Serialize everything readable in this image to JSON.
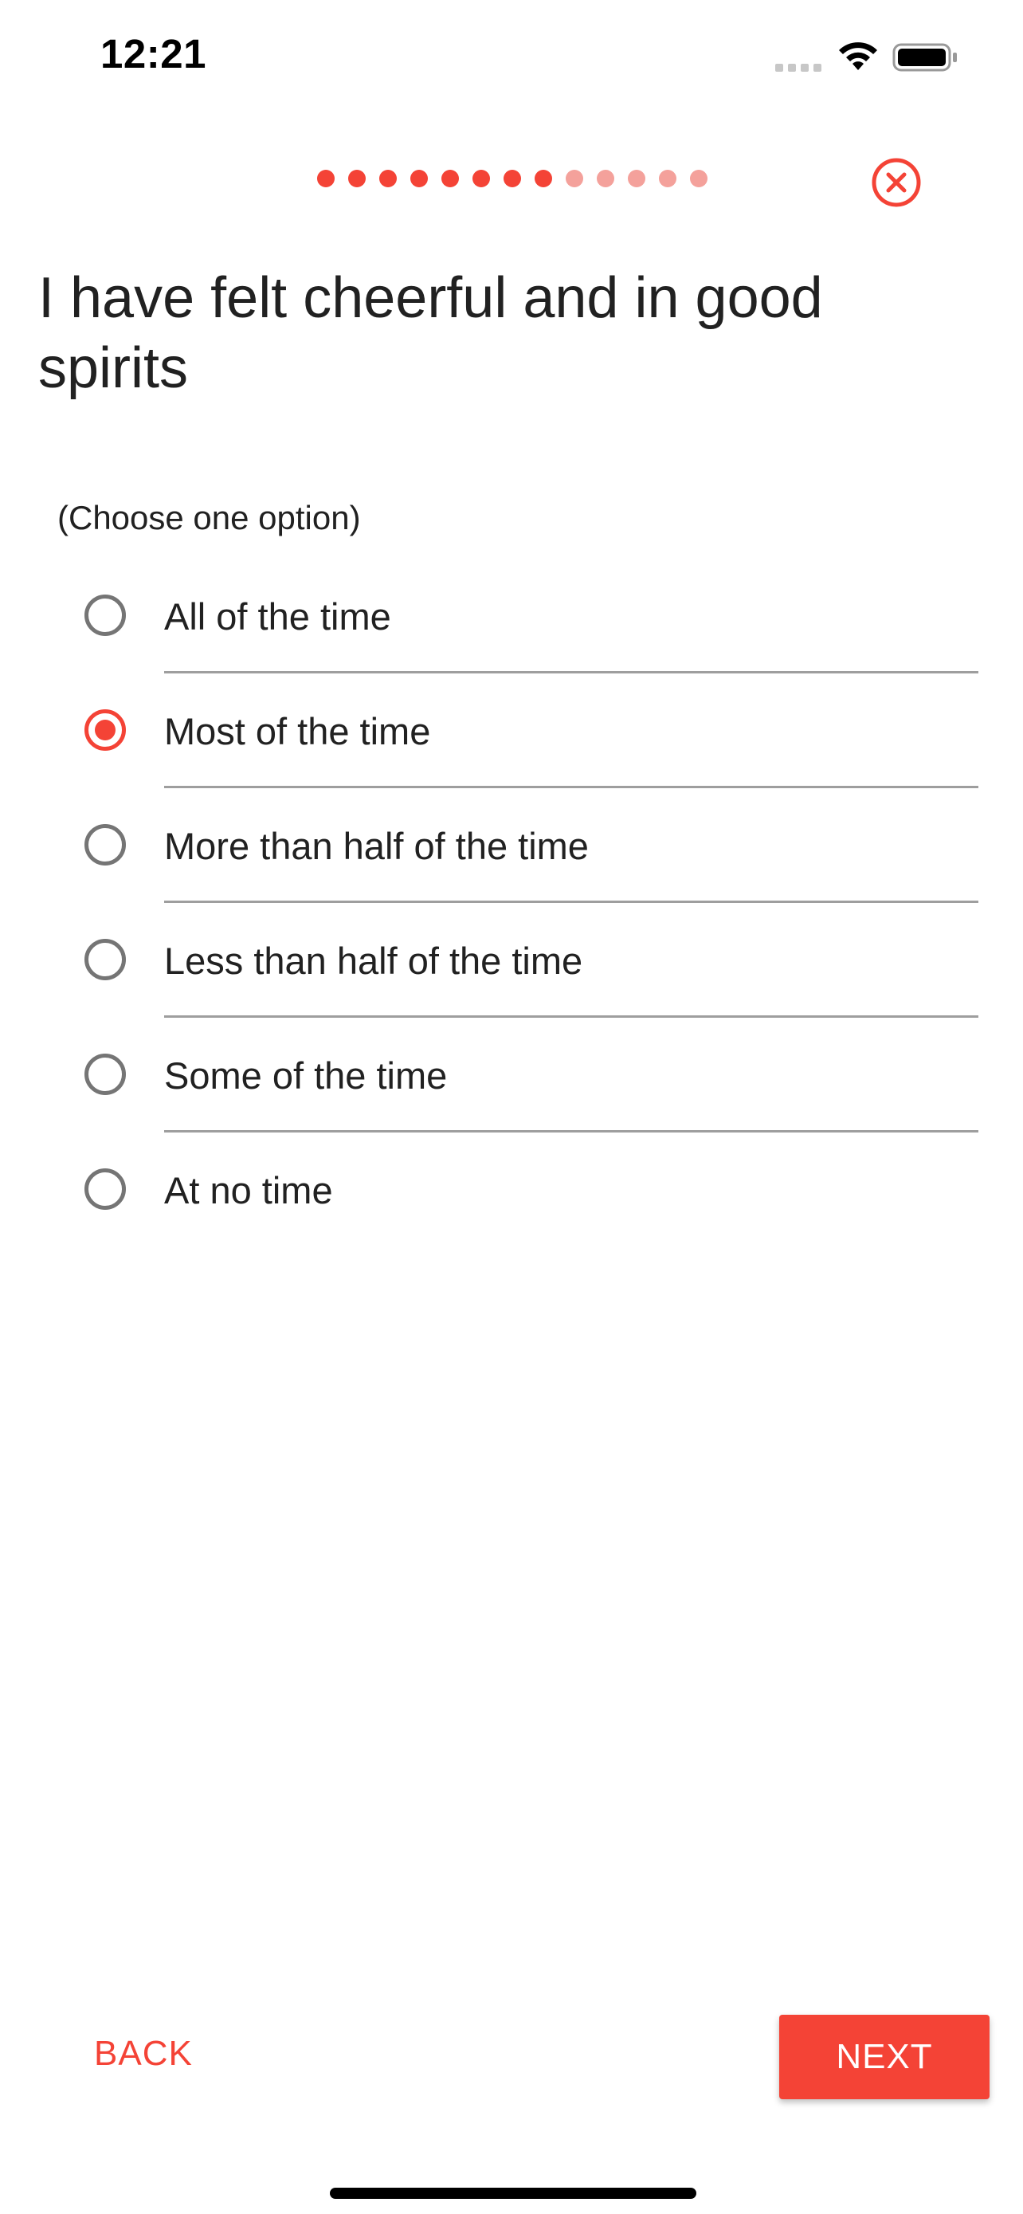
{
  "status_bar": {
    "time": "12:21",
    "signal_icon": "cellular-signal-icon",
    "wifi_icon": "wifi-icon",
    "battery_icon": "battery-full-icon"
  },
  "progress": {
    "total_steps": 13,
    "completed_steps": 8,
    "completed_color": "#f44336",
    "pending_color": "#f4a19b"
  },
  "close_icon": "close-circle-icon",
  "question": "I have felt cheerful and in good spirits",
  "hint": "(Choose one option)",
  "options": [
    {
      "label": "All of the time",
      "selected": false
    },
    {
      "label": "Most of the time",
      "selected": true
    },
    {
      "label": "More than half of the time",
      "selected": false
    },
    {
      "label": "Less than half of the time",
      "selected": false
    },
    {
      "label": "Some of the time",
      "selected": false
    },
    {
      "label": "At no time",
      "selected": false
    }
  ],
  "buttons": {
    "back_label": "BACK",
    "next_label": "NEXT"
  },
  "colors": {
    "accent": "#f44336",
    "text": "#212121",
    "radio_unselected": "#757575"
  }
}
